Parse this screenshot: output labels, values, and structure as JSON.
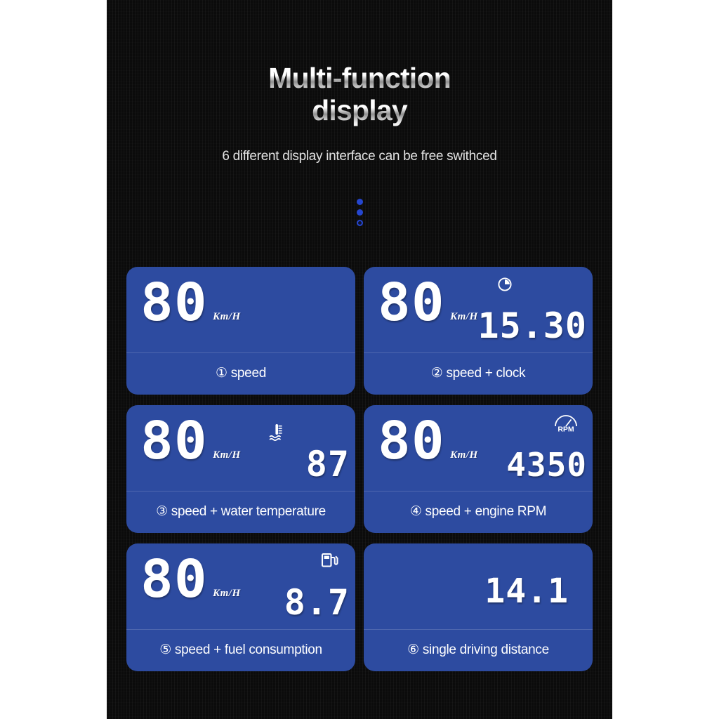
{
  "header": {
    "title_line1": "Multi-function",
    "title_line2": "display",
    "subtitle": "6 different display interface can be free swithced"
  },
  "theme": {
    "panel_bg": "#0b0b0b",
    "card_blue": "#2d4ba0",
    "dot_blue": "#2546cf",
    "digit_color": "#ffffff"
  },
  "carousel": {
    "dots": [
      "filled",
      "filled",
      "ring"
    ]
  },
  "units": {
    "speed_unit": "Km/H"
  },
  "cards": [
    {
      "id": "speed",
      "speed": "80",
      "unit": "Km/H",
      "aux_value": "",
      "aux_icon": "",
      "caption": "① speed"
    },
    {
      "id": "speed-clock",
      "speed": "80",
      "unit": "Km/H",
      "aux_value": "15.30",
      "aux_icon": "clock-icon",
      "caption": "② speed + clock"
    },
    {
      "id": "speed-water-temperature",
      "speed": "80",
      "unit": "Km/H",
      "aux_value": "87",
      "aux_icon": "water-temperature-icon",
      "caption": "③ speed + water temperature"
    },
    {
      "id": "speed-engine-rpm",
      "speed": "80",
      "unit": "Km/H",
      "aux_value": "4350",
      "aux_icon": "rpm-gauge-icon",
      "aux_icon_label": "RPM",
      "caption": "④ speed + engine RPM"
    },
    {
      "id": "speed-fuel-consumption",
      "speed": "80",
      "unit": "Km/H",
      "aux_value": "8.7",
      "aux_icon": "fuel-pump-icon",
      "caption": "⑤ speed + fuel consumption"
    },
    {
      "id": "single-driving-distance",
      "speed": "",
      "unit": "",
      "aux_value": "14.1",
      "aux_icon": "",
      "caption": "⑥ single driving distance"
    }
  ]
}
